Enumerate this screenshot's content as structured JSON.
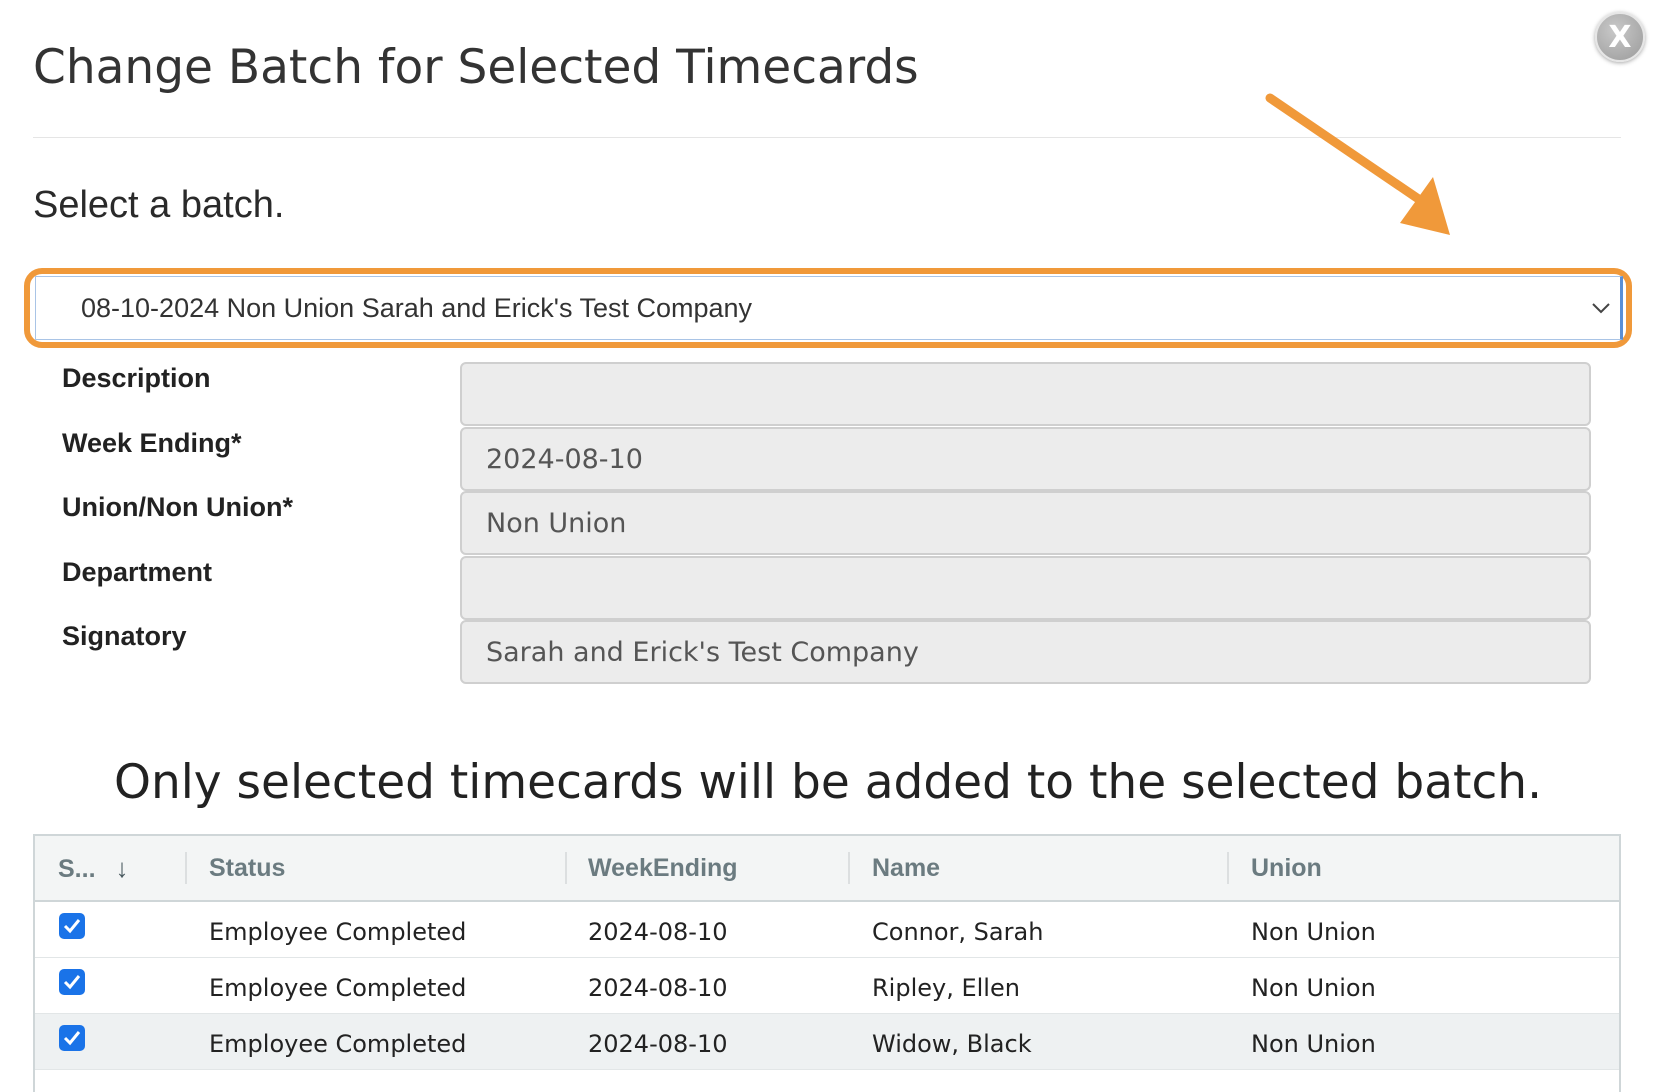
{
  "modal": {
    "title": "Change Batch for Selected Timecards",
    "close_label": "X"
  },
  "batch": {
    "prompt": "Select a batch.",
    "selected": "08-10-2024 Non Union Sarah and Erick's Test Company",
    "highlight_color": "#f0993a"
  },
  "fields": {
    "description": {
      "label": "Description",
      "value": ""
    },
    "week_ending": {
      "label": "Week Ending*",
      "value": "2024-08-10"
    },
    "union": {
      "label": "Union/Non Union*",
      "value": "Non Union"
    },
    "department": {
      "label": "Department",
      "value": ""
    },
    "signatory": {
      "label": "Signatory",
      "value": "Sarah and Erick's Test Company"
    }
  },
  "note": "Only selected timecards will be added to the selected batch.",
  "table": {
    "columns": [
      "S...",
      "Status",
      "WeekEnding",
      "Name",
      "Union"
    ],
    "rows": [
      {
        "selected": true,
        "status": "Employee Completed",
        "week_ending": "2024-08-10",
        "name": "Connor, Sarah",
        "union": "Non Union"
      },
      {
        "selected": true,
        "status": "Employee Completed",
        "week_ending": "2024-08-10",
        "name": "Ripley, Ellen",
        "union": "Non Union"
      },
      {
        "selected": true,
        "status": "Employee Completed",
        "week_ending": "2024-08-10",
        "name": "Widow, Black",
        "union": "Non Union"
      }
    ]
  },
  "colors": {
    "accent_orange": "#f0993a",
    "checkbox_blue": "#1a73e8"
  },
  "icons": {
    "close": "close-icon",
    "select_caret": "chevron-down-icon",
    "sort": "sort-down-arrow-icon",
    "check": "checkmark-icon",
    "annotation": "arrow-annotation-icon"
  }
}
